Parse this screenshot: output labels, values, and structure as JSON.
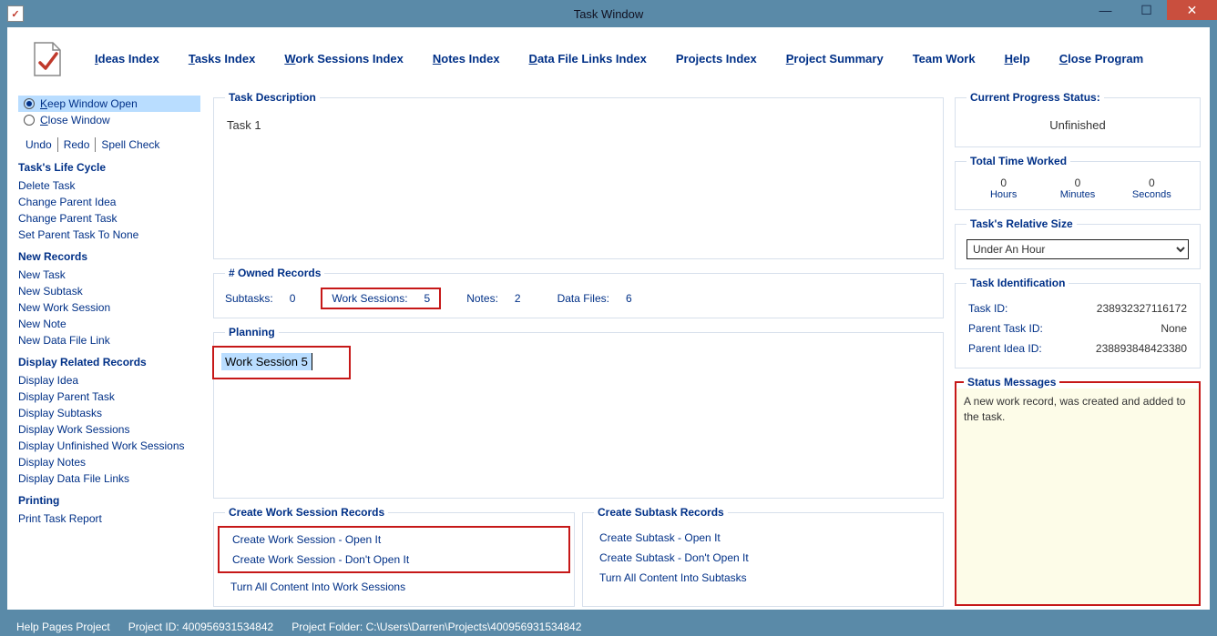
{
  "window": {
    "title": "Task Window"
  },
  "menubar": {
    "items": [
      "Ideas Index",
      "Tasks Index",
      "Work Sessions Index",
      "Notes Index",
      "Data File Links Index",
      "Projects Index",
      "Project Summary",
      "Team Work",
      "Help",
      "Close Program"
    ],
    "accel_pos": [
      0,
      0,
      0,
      0,
      0,
      -1,
      0,
      -1,
      0,
      0
    ]
  },
  "sidebar": {
    "radios": {
      "keep": "Keep Window Open",
      "close": "Close Window",
      "selected": "keep"
    },
    "mini": [
      "Undo",
      "Redo",
      "Spell Check"
    ],
    "sections": [
      {
        "title": "Task's Life Cycle",
        "items": [
          "Delete Task",
          "Change Parent Idea",
          "Change Parent Task",
          "Set Parent Task To None"
        ]
      },
      {
        "title": "New Records",
        "items": [
          "New Task",
          "New Subtask",
          "New Work Session",
          "New Note",
          "New Data File Link"
        ]
      },
      {
        "title": "Display Related Records",
        "items": [
          "Display Idea",
          "Display Parent Task",
          "Display Subtasks",
          "Display Work Sessions",
          "Display Unfinished Work Sessions",
          "Display Notes",
          "Display Data File Links"
        ]
      },
      {
        "title": "Printing",
        "items": [
          "Print Task Report"
        ]
      }
    ]
  },
  "task": {
    "description_title": "Task Description",
    "description": "Task 1",
    "owned_title": "# Owned Records",
    "owned": {
      "subtasks_l": "Subtasks:",
      "subtasks_v": "0",
      "ws_l": "Work Sessions:",
      "ws_v": "5",
      "notes_l": "Notes:",
      "notes_v": "2",
      "df_l": "Data Files:",
      "df_v": "6"
    },
    "planning_title": "Planning",
    "planning_value": "Work Session 5",
    "create_ws_title": "Create Work Session Records",
    "create_ws_items": [
      "Create Work Session - Open It",
      "Create Work Session - Don't Open It",
      "Turn All Content Into Work Sessions"
    ],
    "create_sub_title": "Create Subtask Records",
    "create_sub_items": [
      "Create Subtask - Open It",
      "Create Subtask - Don't Open It",
      "Turn All Content Into Subtasks"
    ]
  },
  "right": {
    "progress_title": "Current Progress Status:",
    "progress_value": "Unfinished",
    "time_title": "Total Time Worked",
    "time": {
      "hours": "0",
      "minutes": "0",
      "seconds": "0",
      "hours_l": "Hours",
      "minutes_l": "Minutes",
      "seconds_l": "Seconds"
    },
    "relsize_title": "Task's Relative Size",
    "relsize_value": "Under An Hour",
    "ident_title": "Task Identification",
    "ident": {
      "task_l": "Task ID:",
      "task_v": "238932327116172",
      "ptask_l": "Parent Task ID:",
      "ptask_v": "None",
      "pidea_l": "Parent Idea ID:",
      "pidea_v": "238893848423380"
    },
    "status_title": "Status Messages",
    "status_msg": "A new work record, was created and added to the task."
  },
  "footer": {
    "help": "Help Pages Project",
    "proj_id_l": "Project ID:",
    "proj_id_v": "400956931534842",
    "folder_l": "Project Folder:",
    "folder_v": "C:\\Users\\Darren\\Projects\\400956931534842"
  }
}
